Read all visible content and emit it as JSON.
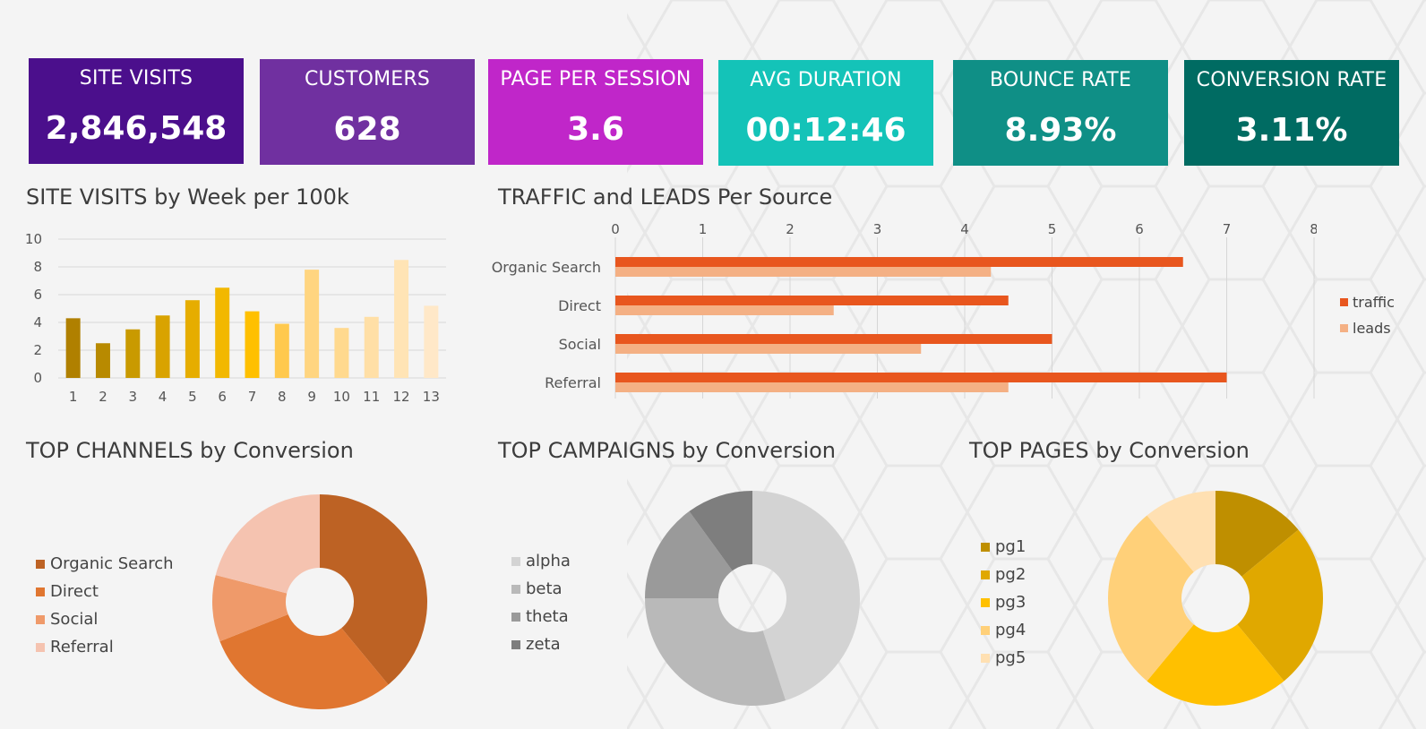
{
  "kpis": [
    {
      "label": "SITE VISITS",
      "value": "2,846,548",
      "color": "#4b0f8c"
    },
    {
      "label": "CUSTOMERS",
      "value": "628",
      "color": "#7030a0"
    },
    {
      "label": "PAGE PER SESSION",
      "value": "3.6",
      "color": "#c026c9"
    },
    {
      "label": "AVG DURATION",
      "value": "00:12:46",
      "color": "#14c3b8"
    },
    {
      "label": "BOUNCE RATE",
      "value": "8.93%",
      "color": "#0f8f86"
    },
    {
      "label": "CONVERSION RATE",
      "value": "3.11%",
      "color": "#006b62"
    }
  ],
  "titles": {
    "site_visits": "SITE VISITS by Week per 100k",
    "traffic": "TRAFFIC and LEADS Per Source",
    "channels": "TOP CHANNELS by Conversion",
    "campaigns": "TOP CAMPAIGNS by Conversion",
    "pages": "TOP PAGES by Conversion"
  },
  "chart_data": [
    {
      "type": "bar",
      "title": "SITE VISITS by Week per 100k",
      "categories": [
        "1",
        "2",
        "3",
        "4",
        "5",
        "6",
        "7",
        "8",
        "9",
        "10",
        "11",
        "12",
        "13"
      ],
      "values": [
        4.3,
        2.5,
        3.5,
        4.5,
        5.6,
        6.5,
        4.8,
        3.9,
        7.8,
        3.6,
        4.4,
        8.5,
        5.2
      ],
      "ylim": [
        0,
        10
      ],
      "yticks": [
        "0",
        "2",
        "4",
        "6",
        "8",
        "10"
      ],
      "grid": true,
      "colors": [
        "#b08000",
        "#b88a00",
        "#c99a00",
        "#d9a300",
        "#e6ad00",
        "#f2b800",
        "#ffc000",
        "#ffc94d",
        "#ffd580",
        "#ffd98e",
        "#ffdfa6",
        "#ffe4b5",
        "#ffe8c8"
      ]
    },
    {
      "type": "bar",
      "orientation": "horizontal",
      "title": "TRAFFIC and LEADS Per Source",
      "categories": [
        "Organic Search",
        "Direct",
        "Social",
        "Referral"
      ],
      "series": [
        {
          "name": "traffic",
          "values": [
            6.5,
            4.5,
            5,
            7
          ],
          "color": "#e8561e"
        },
        {
          "name": "leads",
          "values": [
            4.3,
            2.5,
            3.5,
            4.5
          ],
          "color": "#f4b084"
        }
      ],
      "xlim": [
        0,
        8
      ],
      "xticks": [
        "0",
        "1",
        "2",
        "3",
        "4",
        "5",
        "6",
        "7",
        "8"
      ],
      "grid": true,
      "legend": "right"
    },
    {
      "type": "pie",
      "donut": true,
      "title": "TOP CHANNELS by Conversion",
      "labels": [
        "Organic Search",
        "Direct",
        "Social",
        "Referral"
      ],
      "values": [
        39,
        30,
        10,
        21
      ],
      "colors": [
        "#bd6224",
        "#e07630",
        "#ef9a6a",
        "#f5c3b0"
      ],
      "legend": "left"
    },
    {
      "type": "pie",
      "donut": true,
      "title": "TOP CAMPAIGNS by Conversion",
      "labels": [
        "alpha",
        "beta",
        "theta",
        "zeta"
      ],
      "values": [
        45,
        30,
        15,
        10
      ],
      "colors": [
        "#d3d3d3",
        "#b9b9b9",
        "#9a9a9a",
        "#7e7e7e"
      ],
      "legend": "left"
    },
    {
      "type": "pie",
      "donut": true,
      "title": "TOP PAGES by Conversion",
      "labels": [
        "pg1",
        "pg2",
        "pg3",
        "pg4",
        "pg5"
      ],
      "values": [
        14,
        25,
        22,
        28,
        11
      ],
      "colors": [
        "#bf8f00",
        "#e0a800",
        "#ffc000",
        "#ffd079",
        "#ffe0b2"
      ],
      "legend": "left"
    }
  ]
}
